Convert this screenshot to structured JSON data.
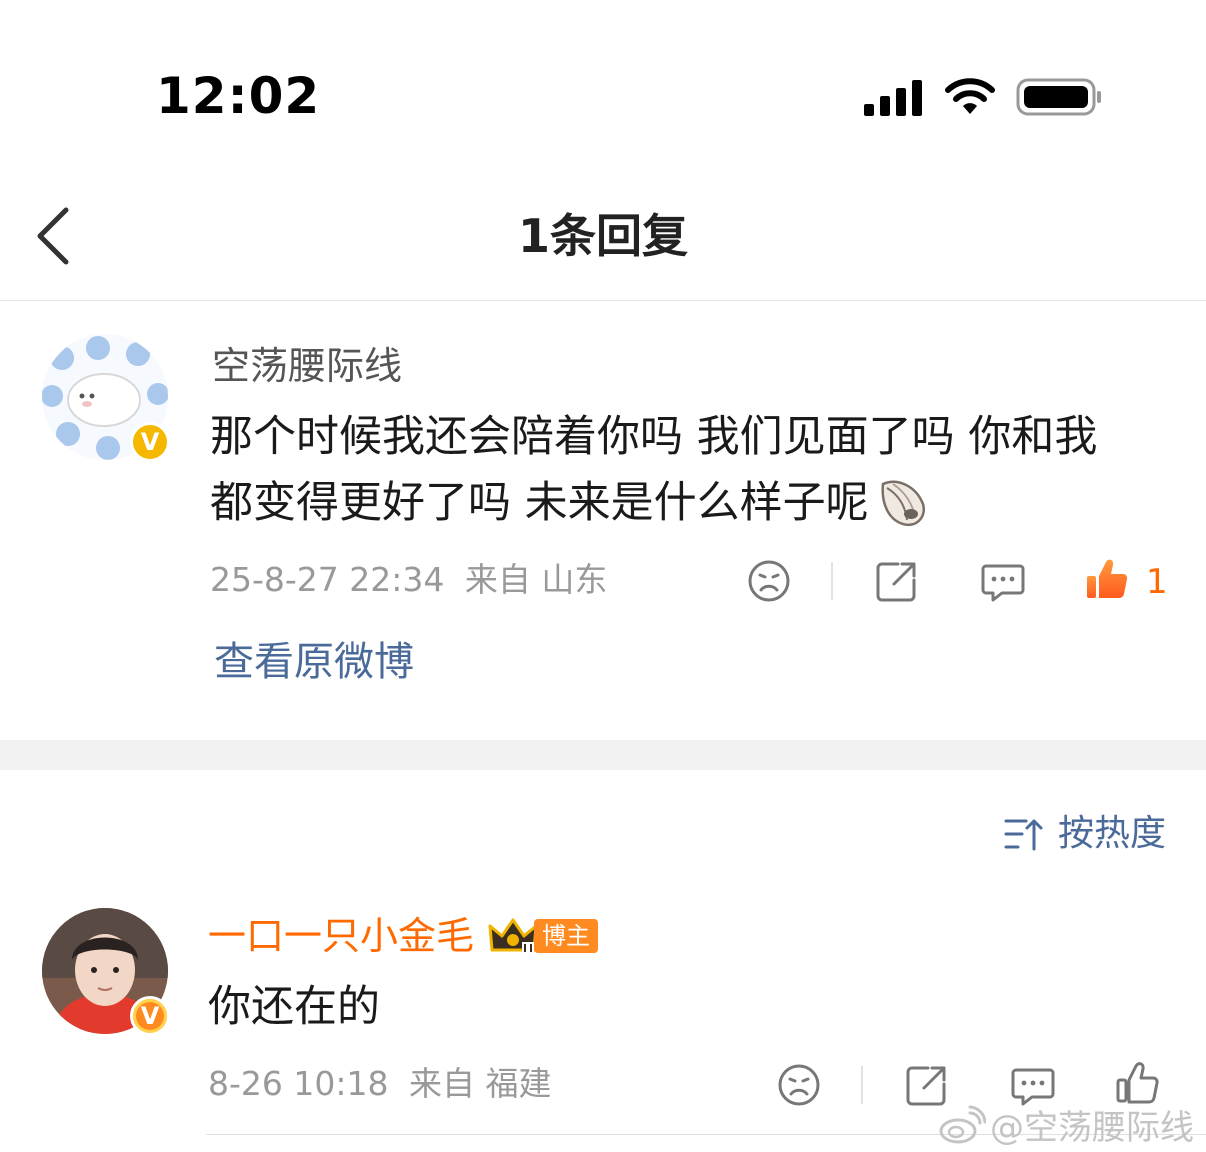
{
  "status_bar": {
    "time": "12:02"
  },
  "header": {
    "title": "1条回复"
  },
  "original_comment": {
    "username": "空荡腰际线",
    "text_line1": "那个时候我还会陪着你吗 我们见面了吗 你和我",
    "text_line2": "都变得更好了吗 未来是什么样子呢",
    "emoji": "shell",
    "timestamp": "25-8-27 22:34",
    "source": "来自 山东",
    "like_count": "1",
    "view_original": "查看原微博"
  },
  "sort": {
    "label": "按热度"
  },
  "reply": {
    "username": "一口一只小金毛",
    "tag": "博主",
    "text": "你还在的",
    "timestamp": "8-26 10:18",
    "source": "来自 福建"
  },
  "watermark": {
    "text": "@空荡腰际线"
  },
  "colors": {
    "accent_orange": "#ff6a00",
    "link_blue": "#4a6a9a",
    "verified_gold": "#f5b800"
  }
}
